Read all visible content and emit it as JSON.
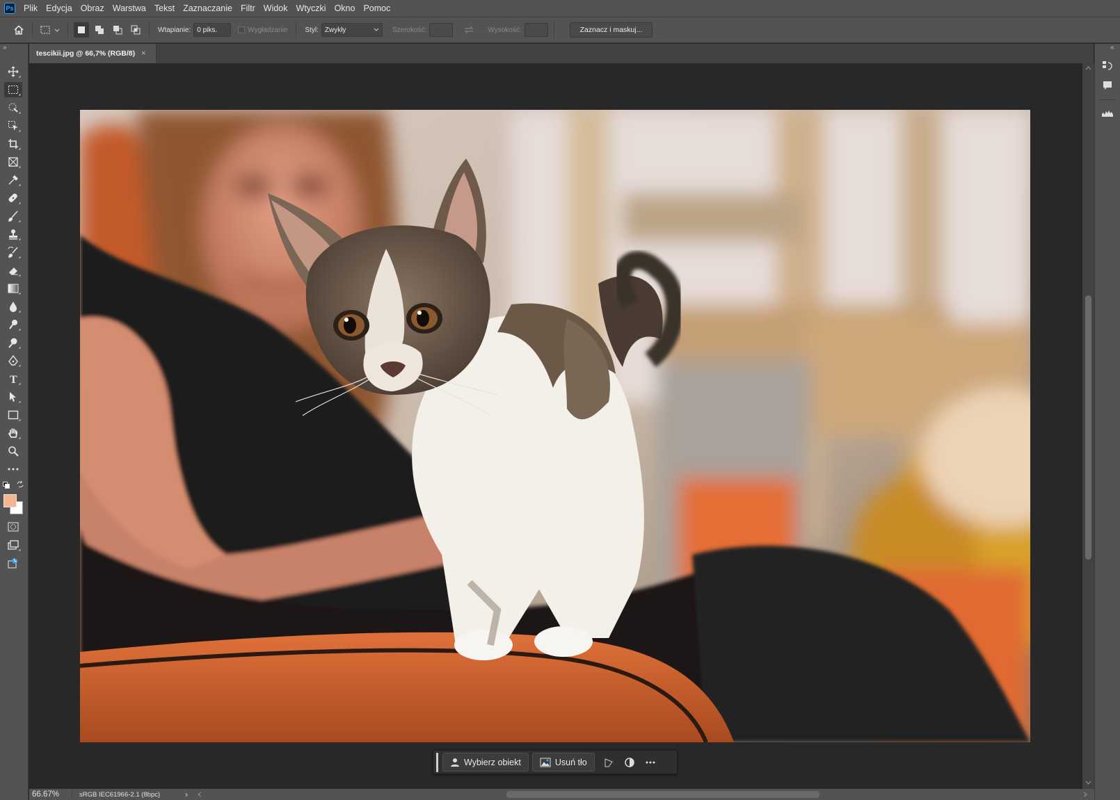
{
  "app": {
    "logo_text": "Ps",
    "menu": [
      "Plik",
      "Edycja",
      "Obraz",
      "Warstwa",
      "Tekst",
      "Zaznaczanie",
      "Filtr",
      "Widok",
      "Wtyczki",
      "Okno",
      "Pomoc"
    ]
  },
  "options": {
    "feather_label": "Wtapianie:",
    "feather_value": "0 piks.",
    "antialias_label": "Wygładzanie",
    "style_label": "Styl:",
    "style_value": "Zwykły",
    "width_label": "Szerokość:",
    "width_value": "",
    "height_label": "Wysokość:",
    "height_value": "",
    "select_mask_label": "Zaznacz i maskuj..."
  },
  "document": {
    "tab_title": "tescikii.jpg @ 66,7% (RGB/8)",
    "close_symbol": "×"
  },
  "tools": [
    "move-icon",
    "rectangular-marquee-icon",
    "object-selection-icon",
    "crop-icon",
    "frame-icon",
    "eyedropper-icon",
    "spot-healing-icon",
    "brush-icon",
    "clone-stamp-icon",
    "history-brush-icon",
    "eraser-icon",
    "gradient-icon",
    "blur-icon",
    "dodge-icon",
    "pen-icon",
    "type-icon",
    "path-selection-icon",
    "rectangle-icon",
    "hand-icon",
    "zoom-icon",
    "more-tools-icon"
  ],
  "colors": {
    "foreground": "#f3b58f",
    "background": "#ffffff",
    "ui_dark": "#535353",
    "canvas_bg": "#282828"
  },
  "contextual_taskbar": {
    "select_subject": "Wybierz obiekt",
    "remove_background": "Usuń tło"
  },
  "status": {
    "zoom": "66.67%",
    "color_profile": "sRGB IEC61966-2.1 (8bpc)",
    "arrow": "›"
  }
}
